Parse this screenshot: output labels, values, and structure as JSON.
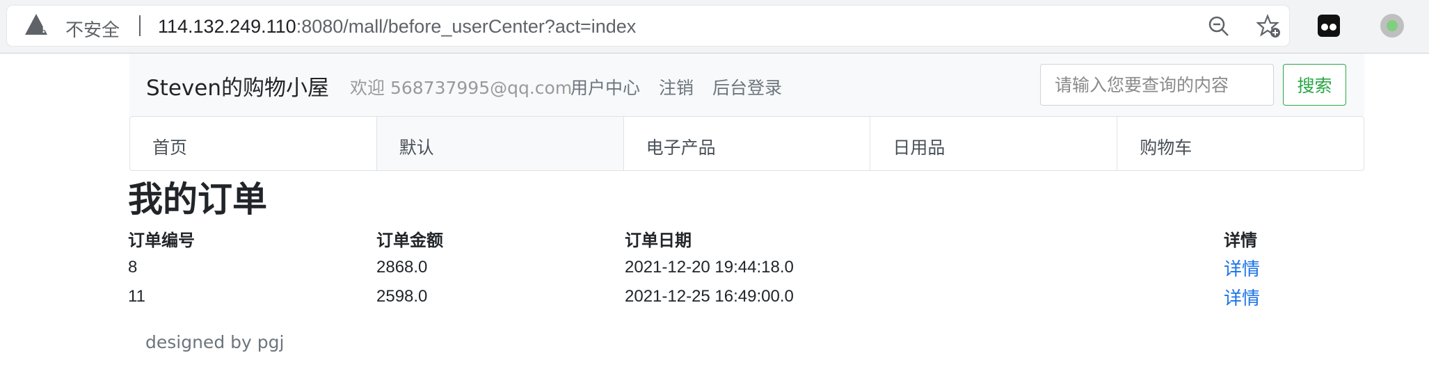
{
  "browser": {
    "insecure_label": "不安全",
    "url_host": "114.132.249.110",
    "url_rest": ":8080/mall/before_userCenter?act=index",
    "icons": [
      "warning-icon",
      "zoom-out-icon",
      "bookmark-star-icon",
      "extension-icon",
      "profile-icon"
    ]
  },
  "navbar": {
    "brand": "Steven的购物小屋",
    "welcome": "欢迎 568737995@qq.com",
    "links": [
      "用户中心",
      "注销",
      "后台登录"
    ],
    "search_placeholder": "请输入您要查询的内容",
    "search_button": "搜索"
  },
  "tabs": [
    {
      "label": "首页",
      "active": false
    },
    {
      "label": "默认",
      "active": true
    },
    {
      "label": "电子产品",
      "active": false
    },
    {
      "label": "日用品",
      "active": false
    },
    {
      "label": "购物车",
      "active": false
    }
  ],
  "main": {
    "title": "我的订单",
    "columns": [
      "订单编号",
      "订单金额",
      "订单日期",
      "详情"
    ],
    "rows": [
      {
        "id": "8",
        "amount": "2868.0",
        "date": "2021-12-20 19:44:18.0",
        "detail": "详情"
      },
      {
        "id": "11",
        "amount": "2598.0",
        "date": "2021-12-25 16:49:00.0",
        "detail": "详情"
      }
    ]
  },
  "footer": "designed by pgj",
  "colors": {
    "link": "#1a73e8",
    "success": "#28a745",
    "muted": "#6c757d"
  }
}
